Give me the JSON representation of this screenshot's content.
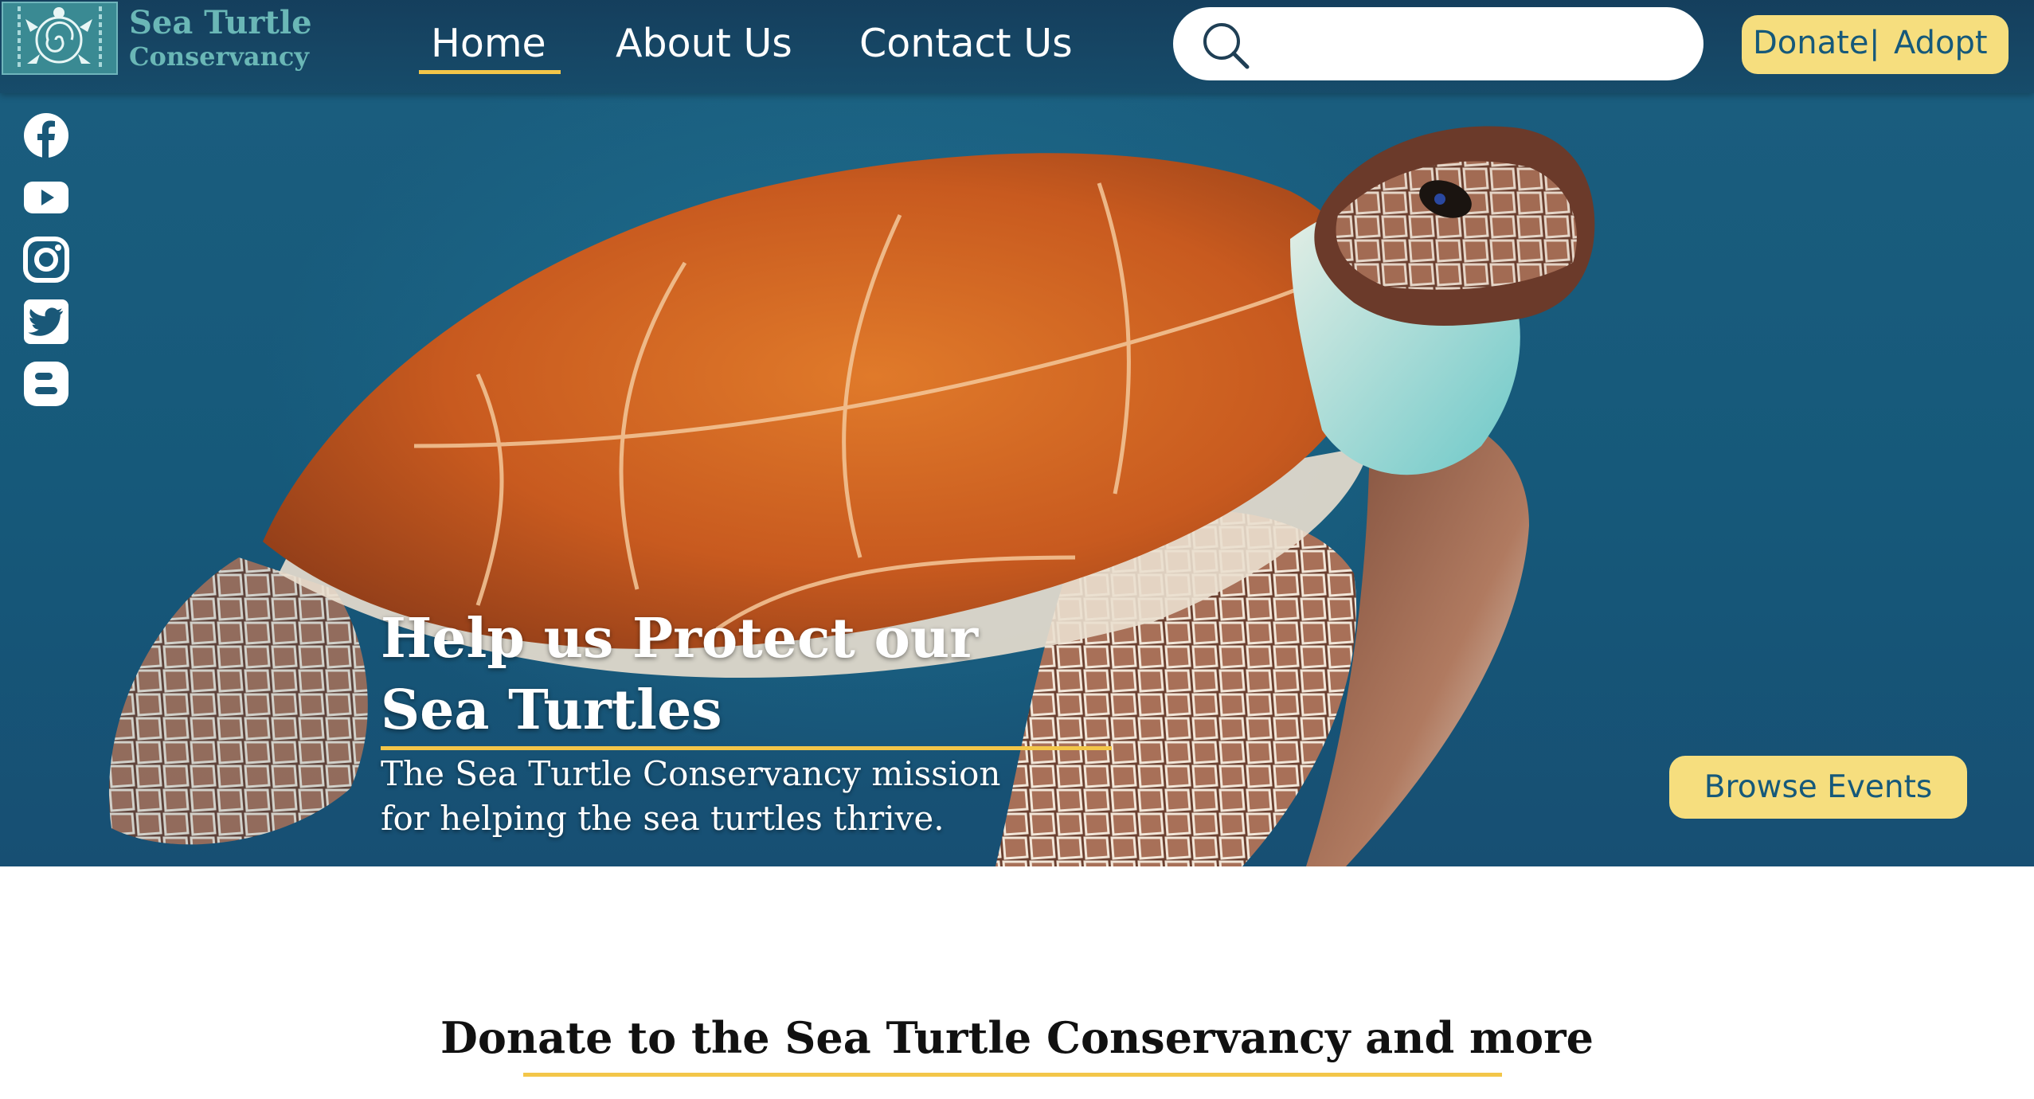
{
  "brand": {
    "name_line1": "Sea Turtle",
    "name_line2": "Conservancy",
    "logo_icon": "turtle-logo-icon",
    "colors": {
      "logo_text": "#6ab7b6",
      "logo_bg": "#3a8a93"
    }
  },
  "nav": {
    "items": [
      {
        "label": "Home",
        "active": true
      },
      {
        "label": "About Us",
        "active": false
      },
      {
        "label": "Contact Us",
        "active": false
      }
    ]
  },
  "search": {
    "placeholder": "",
    "value": "",
    "icon": "search-icon"
  },
  "cta": {
    "donate_label": "Donate",
    "separator": "|",
    "adopt_label": "Adopt"
  },
  "social": [
    {
      "name": "facebook-icon"
    },
    {
      "name": "youtube-icon"
    },
    {
      "name": "instagram-icon"
    },
    {
      "name": "twitter-icon"
    },
    {
      "name": "blogger-icon"
    }
  ],
  "hero": {
    "title": "Help us Protect our Sea Turtles",
    "subtitle": "The Sea Turtle Conservancy mission for helping the sea turtles thrive.",
    "button_label": "Browse Events"
  },
  "section": {
    "title": "Donate to the Sea Turtle Conservancy and more"
  },
  "colors": {
    "accent": "#f3c649",
    "button_bg": "#f6de7e",
    "button_text": "#16597a",
    "header_bg": "#173f5f",
    "ocean": "#16597a"
  }
}
